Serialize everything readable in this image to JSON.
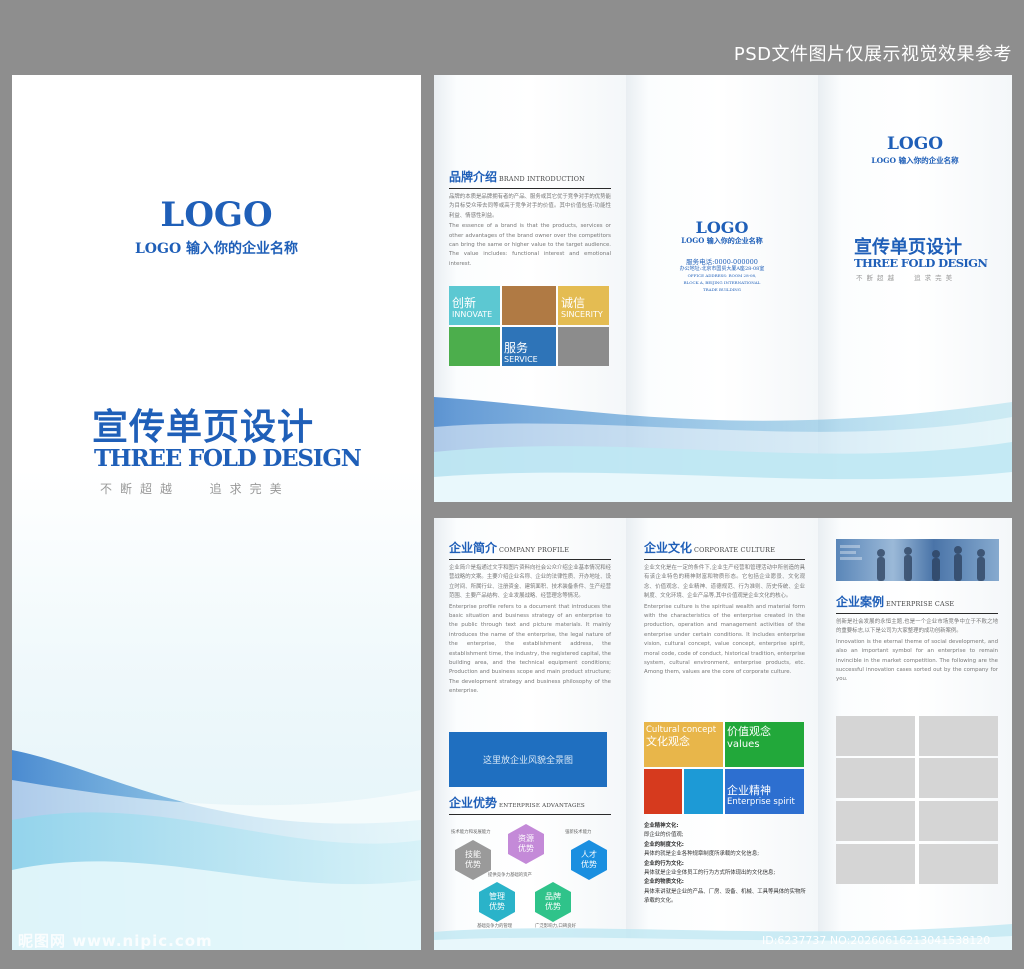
{
  "watermark_top": "PSD文件图片仅展示视觉效果参考",
  "watermark_bottom_left": "昵图网 www.nipic.com",
  "watermark_bottom_right": "ID:6237737 NO:20260616213041538120",
  "cover": {
    "logo": "LOGO",
    "company": "LOGO 输入你的企业名称",
    "title_cn": "宣传单页设计",
    "title_en": "THREE FOLD DESIGN",
    "slogan_left": "不断超越",
    "slogan_right": "追求完美"
  },
  "outer": {
    "brand": {
      "heading_cn": "品牌介绍",
      "heading_en": "BRAND INTRODUCTION",
      "text_cn": "品牌的本质是品牌拥有者的产品、服务或其它优于竞争对手的优势能为目标受众带去同等或高于竞争对手的价值。其中价值包括:功能性利益、情感性利益。",
      "text_en": "The essence of a brand is that the products, services or other advantages of the brand owner over the competitors can bring the same or higher value to the target audience. The value includes: functional interest and emotional interest.",
      "tiles": [
        {
          "cn": "创新",
          "en": "INNOVATE",
          "color": "#5cc8d2"
        },
        {
          "cn": "",
          "en": "",
          "color": "#b07a44"
        },
        {
          "cn": "诚信",
          "en": "SINCERITY",
          "color": "#e4bc52"
        },
        {
          "cn": "",
          "en": "",
          "color": "#4cae4c"
        },
        {
          "cn": "服务",
          "en": "SERVICE",
          "color": "#2e74b8"
        },
        {
          "cn": "",
          "en": "",
          "color": "#8c8c8c"
        }
      ]
    },
    "back": {
      "logo": "LOGO",
      "company": "LOGO 输入你的企业名称",
      "phone": "服务电话:0000-000000",
      "address_cn": "办公地址:北京市国贸大厦A座28-08室",
      "address_en_1": "OFFICE ADDRESS: ROOM 28-08,",
      "address_en_2": "BLOCK A, BEIJING INTERNATIONAL",
      "address_en_3": "TRADE BUILDING"
    },
    "front": {
      "logo": "LOGO",
      "company": "LOGO 输入你的企业名称",
      "title_cn": "宣传单页设计",
      "title_en": "THREE FOLD DESIGN",
      "slogan_left": "不断超越",
      "slogan_right": "追求完美"
    }
  },
  "inner": {
    "profile": {
      "heading_cn": "企业简介",
      "heading_en": "COMPANY PROFILE",
      "text_cn": "企业简介是指通过文字和图片资料向社会公众介绍企业基本情况和经营战略的文案。主要介绍企业名称、企业的法律性质、开办地址、设立时间、所属行业、注册资金、建筑面积、技术装备条件、生产经营范围、主要产品结构、企业发展战略、经营理念等情况。",
      "text_en": "Enterprise profile refers to a document that introduces the basic situation and business strategy of an enterprise to the public through text and picture materials. It mainly introduces the name of the enterprise, the legal nature of the enterprise, the establishment address, the establishment time, the industry, the registered capital, the building area, and the technical equipment conditions; Production and business scope and main product structure; The development strategy and business philosophy of the enterprise.",
      "banner": "这里放企业风貌全景图"
    },
    "advantages": {
      "heading_cn": "企业优势",
      "heading_en": "ENTERPRISE ADVANTAGES",
      "hexes": [
        {
          "label": "资源\n优势",
          "color": "#c48ad8"
        },
        {
          "label": "技能\n优势",
          "color": "#9a9a9a"
        },
        {
          "label": "人才\n优势",
          "color": "#1a8fe0"
        },
        {
          "label": "管理\n优势",
          "color": "#2ab3c9"
        },
        {
          "label": "品牌\n优势",
          "color": "#2fc38a"
        }
      ],
      "notes": [
        "技术能力和发展能力",
        "强新技术能力",
        "提供竞争力基础的资产",
        "基础竞争力的管理",
        "广泛影响力,口碑良好"
      ]
    },
    "culture": {
      "heading_cn": "企业文化",
      "heading_en": "CORPORATE CULTURE",
      "text_cn": "企业文化是在一定的条件下,企业生产经营和管理活动中所创造的具有该企业特色的精神财富和物质形态。它包括企业愿景、文化观念、价值观念、企业精神、道德规范、行为准则、历史传统、企业制度、文化环境、企业产品等,其中价值观是企业文化的核心。",
      "text_en": "Enterprise culture is the spiritual wealth and material form with the characteristics of the enterprise created in the production, operation and management activities of the enterprise under certain conditions. It includes enterprise vision, cultural concept, value concept, enterprise spirit, moral code, code of conduct, historical tradition, enterprise system, cultural environment, enterprise products, etc. Among them, values are the core of corporate culture.",
      "tiles": [
        {
          "cn": "文化观念",
          "en": "Cultural concept",
          "color": "#e8b64a"
        },
        {
          "cn": "价值观念",
          "en": "values",
          "color": "#22a83a"
        },
        {
          "cn": "",
          "en": "",
          "color": "#d63a1e"
        },
        {
          "cn": "",
          "en": "",
          "color": "#1d9ad6"
        },
        {
          "cn": "企业精神",
          "en": "Enterprise spirit",
          "color": "#2d6fd0"
        }
      ],
      "list": [
        {
          "title": "企业精神文化:",
          "text": "即企业的价值观;"
        },
        {
          "title": "企业的制度文化:",
          "text": "具体的就是企业各种规章制度所承载的文化信息;"
        },
        {
          "title": "企业的行为文化:",
          "text": "具体就是企业全体员工的行为方式所体现出的文化信息;"
        },
        {
          "title": "企业的物质文化:",
          "text": "具体来讲就是企业的产品、厂房、设备、机械、工具等具体的实物所承载的文化。"
        }
      ]
    },
    "cases": {
      "heading_cn": "企业案例",
      "heading_en": "ENTERPRISE CASE",
      "text_cn": "创新是社会发展的永恒主题,也是一个企业市场竞争中立于不败之地的重要标志,以下是公司为大家整理的成功创新案例。",
      "text_en": "Innovation is the eternal theme of social development, and also an important symbol for an enterprise to remain invincible in the market competition. The following are the successful innovation cases sorted out by the company for you."
    }
  }
}
